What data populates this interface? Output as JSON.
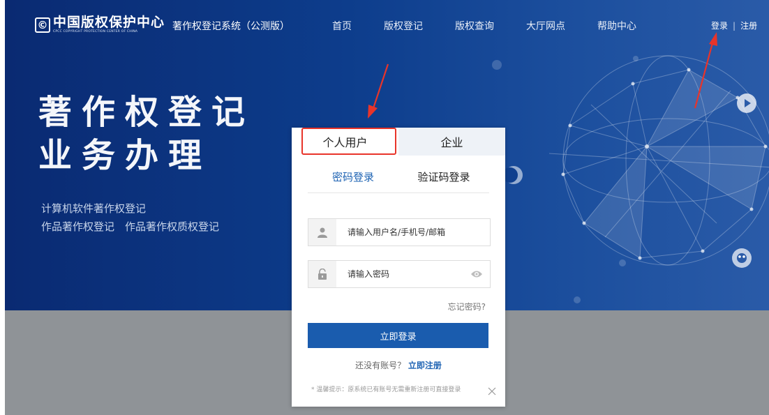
{
  "header": {
    "logo_badge": "©",
    "logo_cn": "中国版权保护中心",
    "logo_en": "CPCC COPYRIGHT PROTECTION CENTER OF CHINA",
    "system_name": "著作权登记系统（公测版）",
    "nav": [
      "首页",
      "版权登记",
      "版权查询",
      "大厅网点",
      "帮助中心"
    ],
    "login_link": "登录",
    "separator": "|",
    "register_link": "注册"
  },
  "hero": {
    "title_line1": "著作权登记",
    "title_line2": "业务办理",
    "sub_line1": "计算机软件著作权登记",
    "sub_line2": "作品著作权登记　作品著作权质权登记"
  },
  "login": {
    "user_tabs": [
      "个人用户",
      "企业"
    ],
    "method_tabs": [
      "密码登录",
      "验证码登录"
    ],
    "username_placeholder": "请输入用户名/手机号/邮箱",
    "password_placeholder": "请输入密码",
    "forgot": "忘记密码?",
    "submit": "立即登录",
    "no_account": "还没有账号？",
    "register_now": "立即注册",
    "tip": "* 温馨提示：原系统已有账号无需重新注册可直接登录"
  },
  "colors": {
    "hero_blue": "#0d3d8c",
    "primary_button": "#1a5cae",
    "link_blue": "#1e63b3",
    "highlight_red": "#e8342a",
    "bottom_gray": "#8f9397"
  }
}
